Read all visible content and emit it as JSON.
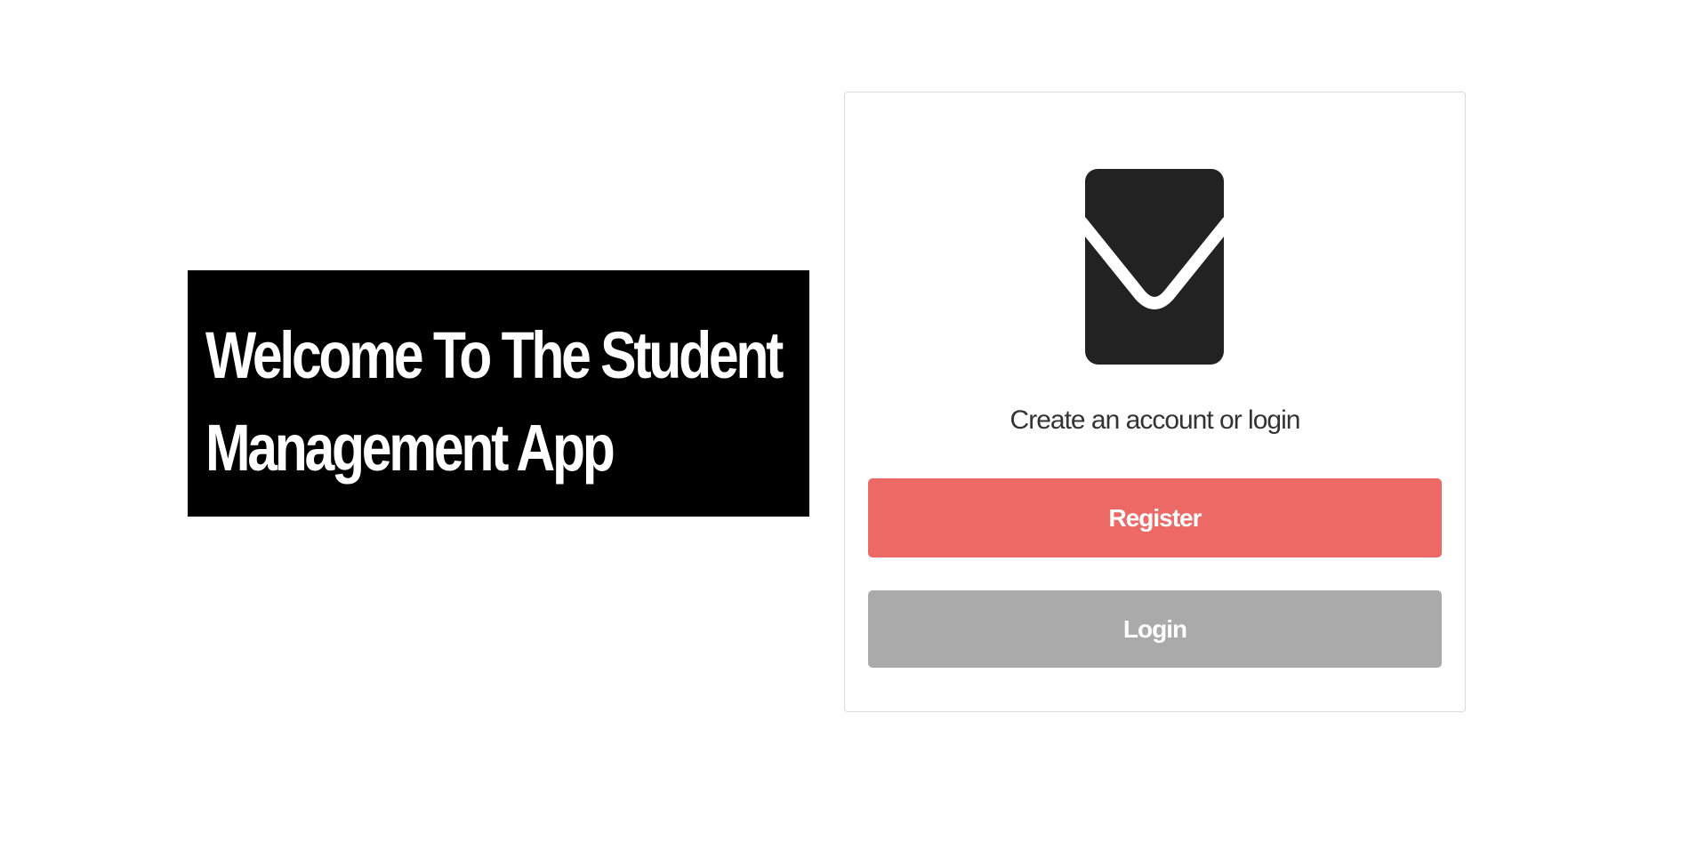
{
  "hero": {
    "title": "Welcome To The Student Management App"
  },
  "auth_card": {
    "logo_icon": "envelope-icon",
    "tagline": "Create an account or login",
    "register_label": "Register",
    "login_label": "Login"
  },
  "colors": {
    "hero_background": "#000000",
    "register_button": "#ec6966",
    "login_button": "#aaaaaa",
    "logo": "#222222"
  }
}
